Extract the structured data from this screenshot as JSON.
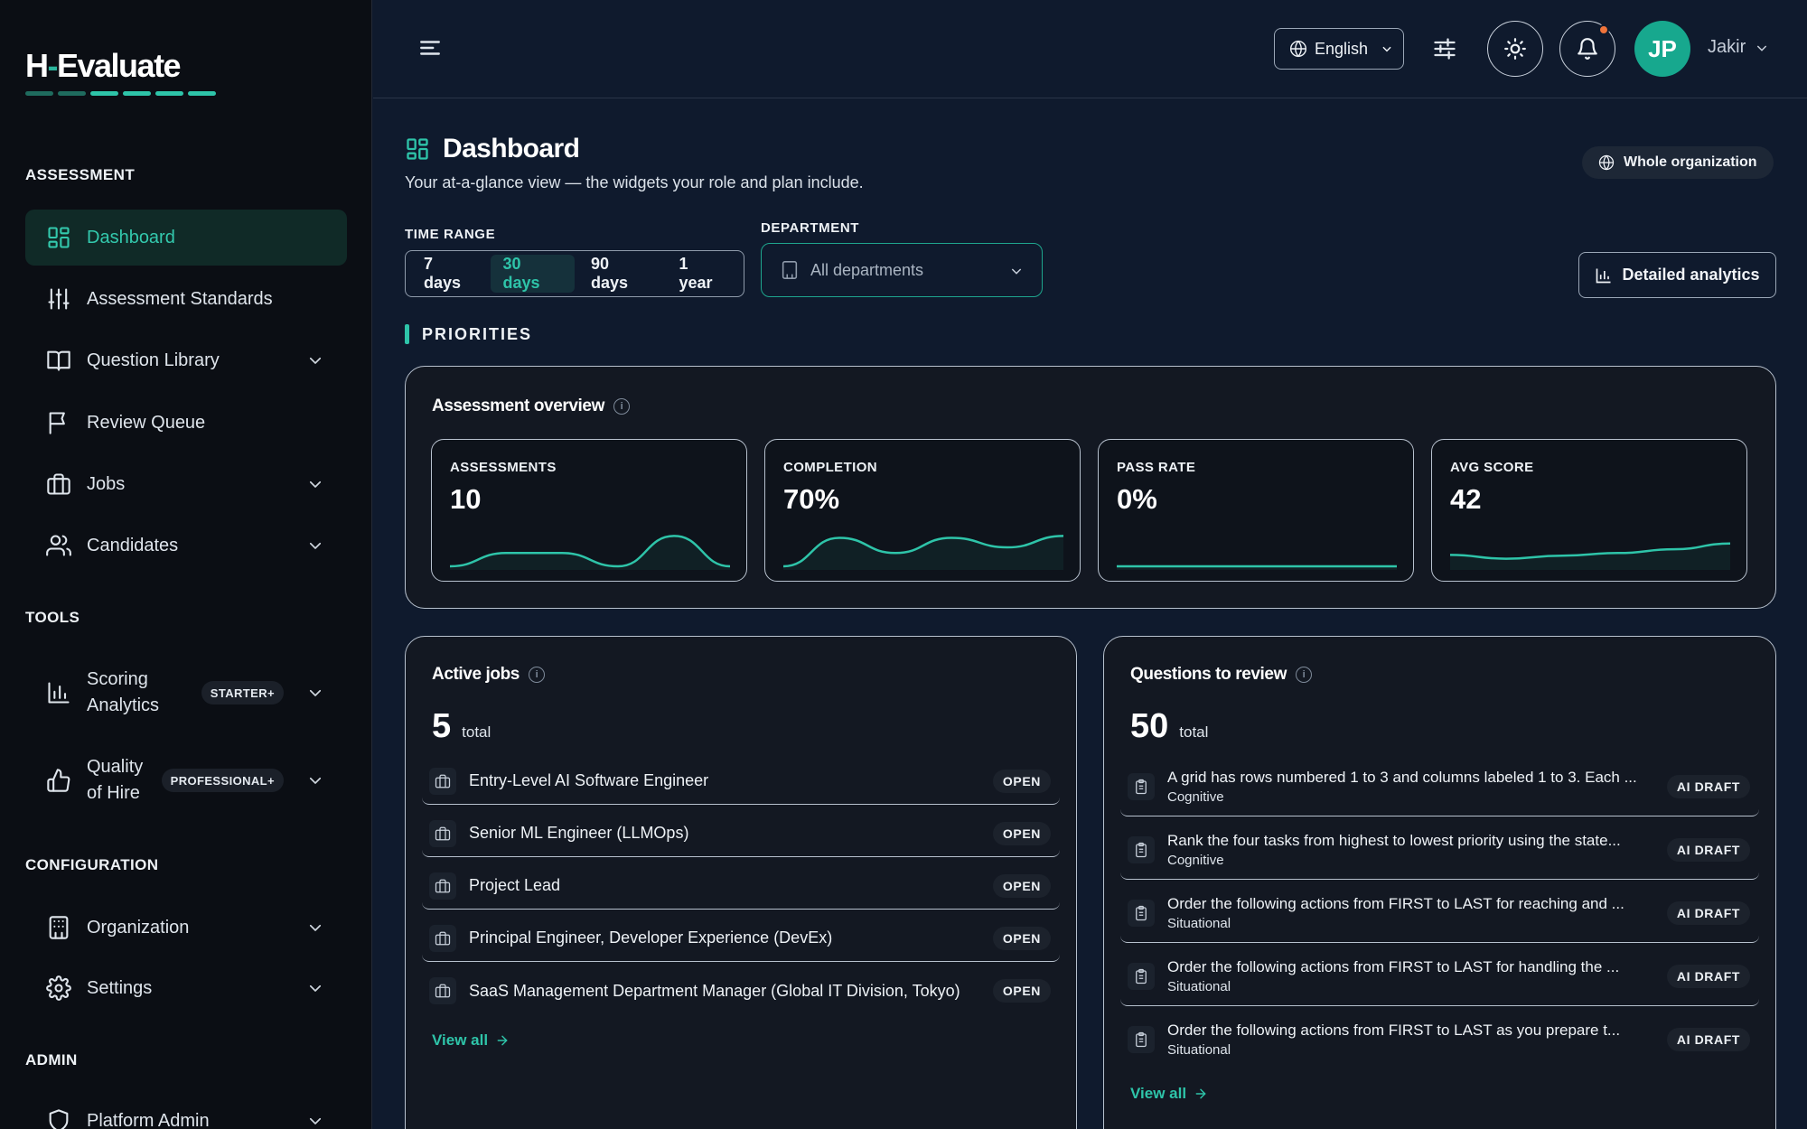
{
  "app": {
    "logo_main": "H",
    "logo_dash": "-",
    "logo_rest": "Evaluate"
  },
  "sidebar": {
    "sections": {
      "assessment": "ASSESSMENT",
      "tools": "TOOLS",
      "configuration": "CONFIGURATION",
      "admin": "ADMIN"
    },
    "items": [
      {
        "label": "Dashboard",
        "icon": "dashboard-icon",
        "active": true
      },
      {
        "label": "Assessment Standards",
        "icon": "sliders-icon"
      },
      {
        "label": "Question Library",
        "icon": "book-icon",
        "expandable": true
      },
      {
        "label": "Review Queue",
        "icon": "flag-icon"
      },
      {
        "label": "Jobs",
        "icon": "briefcase-icon",
        "expandable": true
      },
      {
        "label": "Candidates",
        "icon": "users-icon",
        "expandable": true
      },
      {
        "label_line1": "Scoring",
        "label_line2": "Analytics",
        "tier": "STARTER+",
        "icon": "bar-chart-icon",
        "expandable": true
      },
      {
        "label_line1": "Quality",
        "label_line2": "of Hire",
        "tier": "PROFESSIONAL+",
        "icon": "thumbs-up-icon",
        "expandable": true
      },
      {
        "label": "Organization",
        "icon": "building-icon",
        "expandable": true
      },
      {
        "label": "Settings",
        "icon": "gear-icon",
        "expandable": true
      },
      {
        "label": "Platform Admin",
        "icon": "shield-icon",
        "expandable": true
      }
    ]
  },
  "topbar": {
    "language": "English",
    "user_initials": "JP",
    "user_name": "Jakir",
    "has_notification": true
  },
  "page": {
    "title": "Dashboard",
    "subtitle": "Your at-a-glance view — the widgets your role and plan include.",
    "scope_button": "Whole organization",
    "analytics_button": "Detailed analytics",
    "time_range_label": "TIME RANGE",
    "time_ranges": [
      "7 days",
      "30 days",
      "90 days",
      "1 year"
    ],
    "time_range_selected": "30 days",
    "department_label": "DEPARTMENT",
    "department_value": "All departments",
    "priorities_label": "PRIORITIES"
  },
  "overview": {
    "title": "Assessment overview",
    "kpis": [
      {
        "label": "ASSESSMENTS",
        "value": "10",
        "trend": [
          0.0,
          0.35,
          0.35,
          0.0,
          0.8,
          0.0
        ]
      },
      {
        "label": "COMPLETION",
        "value": "70%",
        "trend": [
          0.0,
          0.75,
          0.35,
          0.75,
          0.5,
          0.8
        ]
      },
      {
        "label": "PASS RATE",
        "value": "0%",
        "trend": [
          0.0,
          0.0,
          0.0,
          0.0,
          0.0,
          0.0
        ]
      },
      {
        "label": "AVG SCORE",
        "value": "42",
        "trend": [
          0.3,
          0.2,
          0.28,
          0.35,
          0.45,
          0.6
        ]
      }
    ]
  },
  "active_jobs": {
    "title": "Active jobs",
    "total": "5",
    "total_label": "total",
    "items": [
      {
        "title": "Entry-Level AI Software Engineer",
        "status": "OPEN"
      },
      {
        "title": "Senior ML Engineer (LLMOps)",
        "status": "OPEN"
      },
      {
        "title": "Project Lead",
        "status": "OPEN"
      },
      {
        "title": "Principal Engineer, Developer Experience (DevEx)",
        "status": "OPEN"
      },
      {
        "title": "SaaS Management Department Manager (Global IT Division, Tokyo)",
        "status": "OPEN"
      }
    ],
    "view_all": "View all"
  },
  "questions": {
    "title": "Questions to review",
    "total": "50",
    "total_label": "total",
    "items": [
      {
        "text": "A grid has rows numbered 1 to 3 and columns labeled 1 to 3. Each ...",
        "category": "Cognitive",
        "status": "AI DRAFT"
      },
      {
        "text": "Rank the four tasks from highest to lowest priority using the state...",
        "category": "Cognitive",
        "status": "AI DRAFT"
      },
      {
        "text": "Order the following actions from FIRST to LAST for reaching and ...",
        "category": "Situational",
        "status": "AI DRAFT"
      },
      {
        "text": "Order the following actions from FIRST to LAST for handling the ...",
        "category": "Situational",
        "status": "AI DRAFT"
      },
      {
        "text": "Order the following actions from FIRST to LAST as you prepare t...",
        "category": "Situational",
        "status": "AI DRAFT"
      }
    ],
    "view_all": "View all"
  },
  "colors": {
    "accent": "#2ec4a9",
    "background": "#0f1a2d",
    "sidebar": "#0b0e14",
    "notification_dot": "#f0743b"
  }
}
